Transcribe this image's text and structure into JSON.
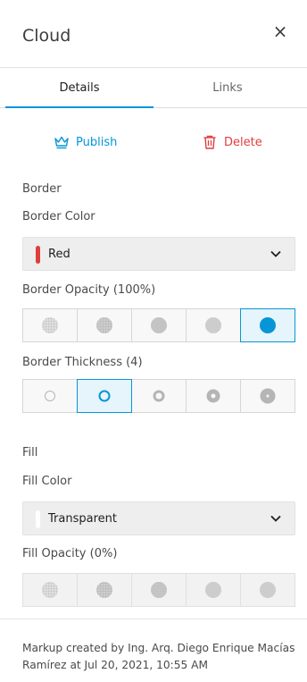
{
  "header": {
    "title": "Cloud",
    "close_glyph": "×"
  },
  "tabs": [
    {
      "label": "Details",
      "active": true
    },
    {
      "label": "Links",
      "active": false
    }
  ],
  "actions": {
    "publish_label": "Publish",
    "delete_label": "Delete",
    "publish_icon": "crown-icon",
    "delete_icon": "trash-icon"
  },
  "border": {
    "section_label": "Border",
    "color_label": "Border Color",
    "color_value": "Red",
    "color_swatch": "#e03d3d",
    "opacity_label": "Border Opacity (100%)",
    "opacity_selected_index": 4,
    "thickness_label": "Border Thickness (4)",
    "thickness_selected_index": 1
  },
  "fill": {
    "section_label": "Fill",
    "color_label": "Fill Color",
    "color_value": "Transparent",
    "color_swatch": "#ffffff",
    "opacity_label": "Fill Opacity (0%)"
  },
  "footer": {
    "text": "Markup created by Ing. Arq. Diego Enrique Macías Ramírez at Jul 20, 2021, 10:55 AM"
  },
  "colors": {
    "accent": "#0696d7",
    "danger": "#e03d3d"
  }
}
